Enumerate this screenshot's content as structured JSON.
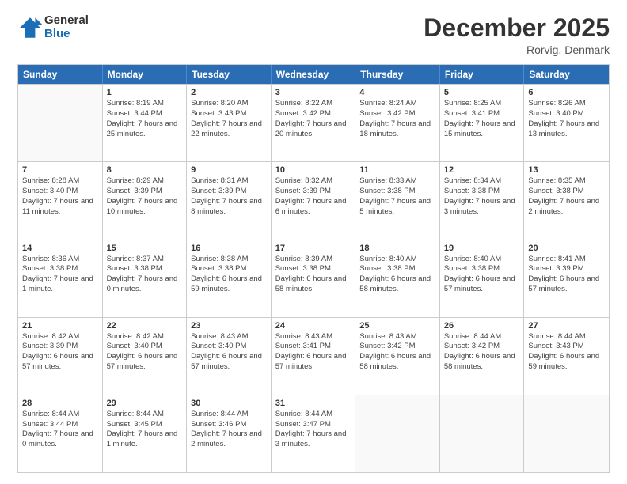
{
  "logo": {
    "general": "General",
    "blue": "Blue"
  },
  "title": "December 2025",
  "subtitle": "Rorvig, Denmark",
  "days_of_week": [
    "Sunday",
    "Monday",
    "Tuesday",
    "Wednesday",
    "Thursday",
    "Friday",
    "Saturday"
  ],
  "weeks": [
    [
      {
        "day": "",
        "empty": true
      },
      {
        "day": "1",
        "sunrise": "8:19 AM",
        "sunset": "3:44 PM",
        "daylight": "7 hours and 25 minutes."
      },
      {
        "day": "2",
        "sunrise": "8:20 AM",
        "sunset": "3:43 PM",
        "daylight": "7 hours and 22 minutes."
      },
      {
        "day": "3",
        "sunrise": "8:22 AM",
        "sunset": "3:42 PM",
        "daylight": "7 hours and 20 minutes."
      },
      {
        "day": "4",
        "sunrise": "8:24 AM",
        "sunset": "3:42 PM",
        "daylight": "7 hours and 18 minutes."
      },
      {
        "day": "5",
        "sunrise": "8:25 AM",
        "sunset": "3:41 PM",
        "daylight": "7 hours and 15 minutes."
      },
      {
        "day": "6",
        "sunrise": "8:26 AM",
        "sunset": "3:40 PM",
        "daylight": "7 hours and 13 minutes."
      }
    ],
    [
      {
        "day": "7",
        "sunrise": "8:28 AM",
        "sunset": "3:40 PM",
        "daylight": "7 hours and 11 minutes."
      },
      {
        "day": "8",
        "sunrise": "8:29 AM",
        "sunset": "3:39 PM",
        "daylight": "7 hours and 10 minutes."
      },
      {
        "day": "9",
        "sunrise": "8:31 AM",
        "sunset": "3:39 PM",
        "daylight": "7 hours and 8 minutes."
      },
      {
        "day": "10",
        "sunrise": "8:32 AM",
        "sunset": "3:39 PM",
        "daylight": "7 hours and 6 minutes."
      },
      {
        "day": "11",
        "sunrise": "8:33 AM",
        "sunset": "3:38 PM",
        "daylight": "7 hours and 5 minutes."
      },
      {
        "day": "12",
        "sunrise": "8:34 AM",
        "sunset": "3:38 PM",
        "daylight": "7 hours and 3 minutes."
      },
      {
        "day": "13",
        "sunrise": "8:35 AM",
        "sunset": "3:38 PM",
        "daylight": "7 hours and 2 minutes."
      }
    ],
    [
      {
        "day": "14",
        "sunrise": "8:36 AM",
        "sunset": "3:38 PM",
        "daylight": "7 hours and 1 minute."
      },
      {
        "day": "15",
        "sunrise": "8:37 AM",
        "sunset": "3:38 PM",
        "daylight": "7 hours and 0 minutes."
      },
      {
        "day": "16",
        "sunrise": "8:38 AM",
        "sunset": "3:38 PM",
        "daylight": "6 hours and 59 minutes."
      },
      {
        "day": "17",
        "sunrise": "8:39 AM",
        "sunset": "3:38 PM",
        "daylight": "6 hours and 58 minutes."
      },
      {
        "day": "18",
        "sunrise": "8:40 AM",
        "sunset": "3:38 PM",
        "daylight": "6 hours and 58 minutes."
      },
      {
        "day": "19",
        "sunrise": "8:40 AM",
        "sunset": "3:38 PM",
        "daylight": "6 hours and 57 minutes."
      },
      {
        "day": "20",
        "sunrise": "8:41 AM",
        "sunset": "3:39 PM",
        "daylight": "6 hours and 57 minutes."
      }
    ],
    [
      {
        "day": "21",
        "sunrise": "8:42 AM",
        "sunset": "3:39 PM",
        "daylight": "6 hours and 57 minutes."
      },
      {
        "day": "22",
        "sunrise": "8:42 AM",
        "sunset": "3:40 PM",
        "daylight": "6 hours and 57 minutes."
      },
      {
        "day": "23",
        "sunrise": "8:43 AM",
        "sunset": "3:40 PM",
        "daylight": "6 hours and 57 minutes."
      },
      {
        "day": "24",
        "sunrise": "8:43 AM",
        "sunset": "3:41 PM",
        "daylight": "6 hours and 57 minutes."
      },
      {
        "day": "25",
        "sunrise": "8:43 AM",
        "sunset": "3:42 PM",
        "daylight": "6 hours and 58 minutes."
      },
      {
        "day": "26",
        "sunrise": "8:44 AM",
        "sunset": "3:42 PM",
        "daylight": "6 hours and 58 minutes."
      },
      {
        "day": "27",
        "sunrise": "8:44 AM",
        "sunset": "3:43 PM",
        "daylight": "6 hours and 59 minutes."
      }
    ],
    [
      {
        "day": "28",
        "sunrise": "8:44 AM",
        "sunset": "3:44 PM",
        "daylight": "7 hours and 0 minutes."
      },
      {
        "day": "29",
        "sunrise": "8:44 AM",
        "sunset": "3:45 PM",
        "daylight": "7 hours and 1 minute."
      },
      {
        "day": "30",
        "sunrise": "8:44 AM",
        "sunset": "3:46 PM",
        "daylight": "7 hours and 2 minutes."
      },
      {
        "day": "31",
        "sunrise": "8:44 AM",
        "sunset": "3:47 PM",
        "daylight": "7 hours and 3 minutes."
      },
      {
        "day": "",
        "empty": true
      },
      {
        "day": "",
        "empty": true
      },
      {
        "day": "",
        "empty": true
      }
    ]
  ]
}
